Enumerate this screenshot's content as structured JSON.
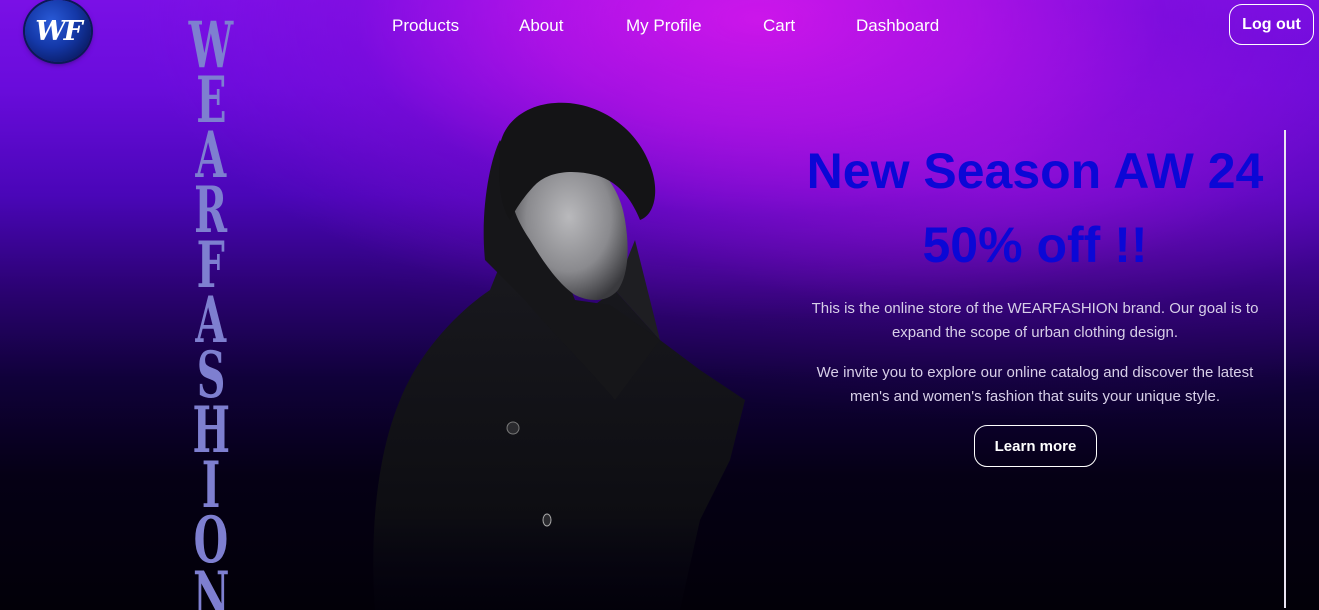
{
  "logo": {
    "text": "WF"
  },
  "nav": {
    "items": [
      {
        "label": "Products"
      },
      {
        "label": "About"
      },
      {
        "label": "My Profile"
      },
      {
        "label": "Cart"
      },
      {
        "label": "Dashboard"
      }
    ],
    "logout_label": "Log out"
  },
  "brand_vertical": [
    "W",
    "E",
    "A",
    "R",
    "F",
    "A",
    "S",
    "H",
    "I",
    "O",
    "N"
  ],
  "hero": {
    "title": "New Season AW 24",
    "subtitle": "50% off !!",
    "paragraph1": "This is the online store of the WEARFASHION brand. Our goal is to expand the scope of urban clothing design.",
    "paragraph2": "We invite you to explore our online catalog and discover the latest men's and women's fashion that suits your unique style.",
    "cta_label": "Learn more"
  },
  "colors": {
    "headline": "#0b07d6",
    "gradient_top": "#d41cf0",
    "gradient_bottom": "#020008",
    "brand_letters": "#7e7fd0"
  }
}
